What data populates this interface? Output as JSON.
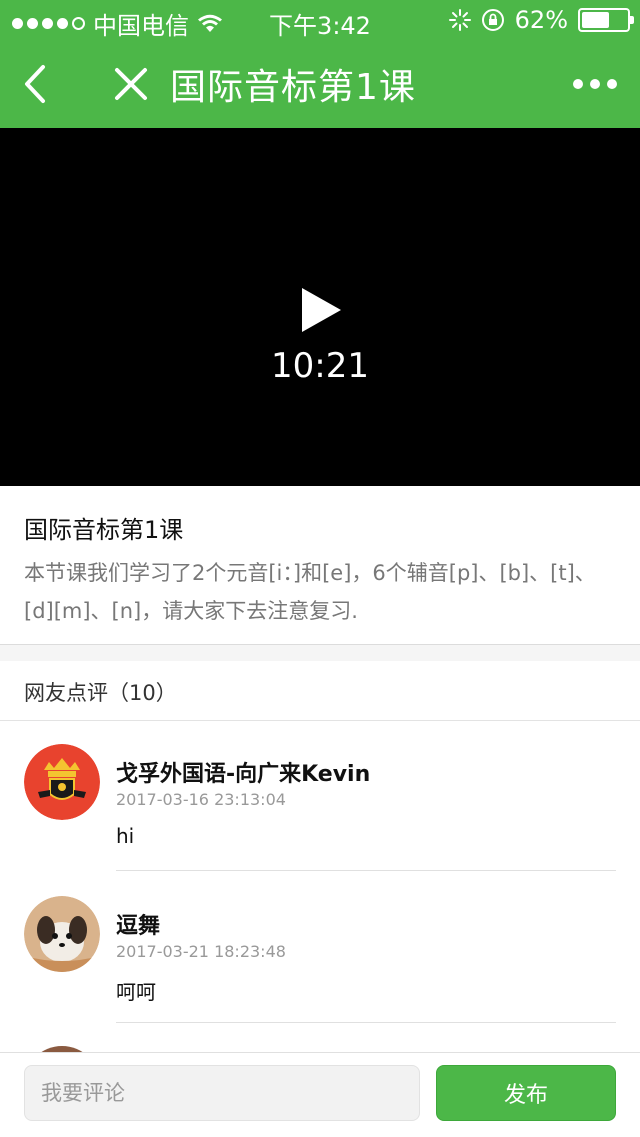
{
  "status_bar": {
    "carrier": "中国电信",
    "time": "下午3:42",
    "battery": "62%",
    "battery_level": 0.62
  },
  "nav": {
    "title": "国际音标第1课",
    "back_icon": "chevron-left-icon",
    "close_icon": "close-icon",
    "more_icon": "more-icon"
  },
  "video": {
    "duration": "10:21",
    "play_icon": "play-icon"
  },
  "lesson": {
    "title": "国际音标第1课",
    "description": "本节课我们学习了2个元音[i：]和[e]，6个辅音[p]、[b]、[t]、[d][m]、[n]，请大家下去注意复习."
  },
  "comments": {
    "header": "网友点评（10）",
    "items": [
      {
        "name": "戈孚外国语-向广来Kevin",
        "time": "2017-03-16 23:13:04",
        "text": "hi",
        "avatar": "school-crest-avatar"
      },
      {
        "name": "逗舞",
        "time": "2017-03-21 18:23:48",
        "text": "呵呵",
        "avatar": "puppy-avatar"
      }
    ]
  },
  "bottom_bar": {
    "input_placeholder": "我要评论",
    "publish_label": "发布"
  },
  "colors": {
    "brand_green": "#4cb748",
    "video_bg": "#000000",
    "muted_text": "#999999"
  }
}
